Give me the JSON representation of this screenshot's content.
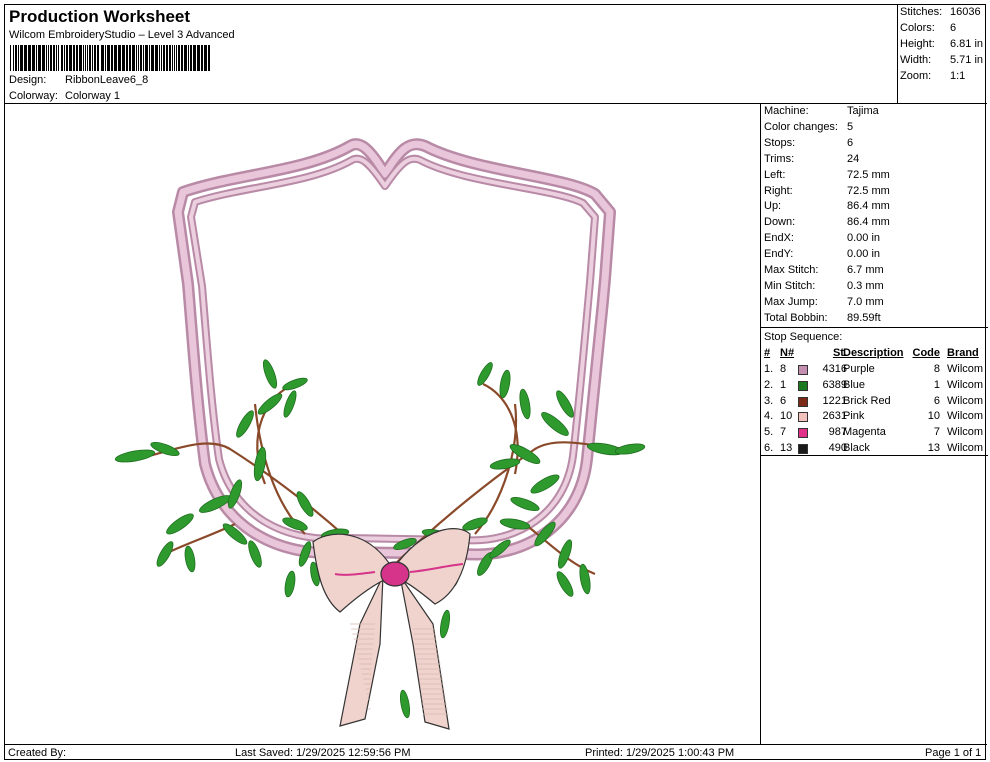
{
  "header": {
    "title": "Production Worksheet",
    "subtitle": "Wilcom EmbroideryStudio – Level 3 Advanced",
    "design_label": "Design:",
    "design_value": "RibbonLeave6_8",
    "colorway_label": "Colorway:",
    "colorway_value": "Colorway 1"
  },
  "summary": [
    {
      "label": "Stitches:",
      "value": "16036"
    },
    {
      "label": "Colors:",
      "value": "6"
    },
    {
      "label": "Height:",
      "value": "6.81 in"
    },
    {
      "label": "Width:",
      "value": "5.71 in"
    },
    {
      "label": "Zoom:",
      "value": "1:1"
    }
  ],
  "machine_info": [
    {
      "label": "Machine:",
      "value": "Tajima"
    },
    {
      "label": "Color changes:",
      "value": "5"
    },
    {
      "label": "Stops:",
      "value": "6"
    },
    {
      "label": "Trims:",
      "value": "24"
    },
    {
      "label": "Left:",
      "value": "72.5 mm"
    },
    {
      "label": "Right:",
      "value": "72.5 mm"
    },
    {
      "label": "Up:",
      "value": "86.4 mm"
    },
    {
      "label": "Down:",
      "value": "86.4 mm"
    },
    {
      "label": "EndX:",
      "value": "0.00 in"
    },
    {
      "label": "EndY:",
      "value": "0.00 in"
    },
    {
      "label": "Max Stitch:",
      "value": "6.7 mm"
    },
    {
      "label": "Min Stitch:",
      "value": "0.3 mm"
    },
    {
      "label": "Max Jump:",
      "value": "7.0 mm"
    },
    {
      "label": "Total Bobbin:",
      "value": "89.59ft"
    }
  ],
  "stop_sequence": {
    "title": "Stop Sequence:",
    "headers": {
      "idx": "#",
      "n": "N#",
      "st": "St.",
      "desc": "Description",
      "code": "Code",
      "brand": "Brand"
    },
    "rows": [
      {
        "idx": "1.",
        "n": "8",
        "color": "#c48fb0",
        "st": "4316",
        "desc": "Purple",
        "code": "8",
        "brand": "Wilcom"
      },
      {
        "idx": "2.",
        "n": "1",
        "color": "#1a7a1f",
        "st": "6389",
        "desc": "Blue",
        "code": "1",
        "brand": "Wilcom"
      },
      {
        "idx": "3.",
        "n": "6",
        "color": "#7a2a16",
        "st": "1221",
        "desc": "Brick Red",
        "code": "6",
        "brand": "Wilcom"
      },
      {
        "idx": "4.",
        "n": "10",
        "color": "#f2c2bc",
        "st": "2631",
        "desc": "Pink",
        "code": "10",
        "brand": "Wilcom"
      },
      {
        "idx": "5.",
        "n": "7",
        "color": "#e0308a",
        "st": "987",
        "desc": "Magenta",
        "code": "7",
        "brand": "Wilcom"
      },
      {
        "idx": "6.",
        "n": "13",
        "color": "#1a1a1a",
        "st": "490",
        "desc": "Black",
        "code": "13",
        "brand": "Wilcom"
      }
    ]
  },
  "footer": {
    "created_by": "Created By:",
    "last_saved": "Last Saved: 1/29/2025 12:59:56 PM",
    "printed": "Printed: 1/29/2025 1:00:43 PM",
    "page": "Page 1 of 1"
  },
  "colors": {
    "frame_pink": "#d7a8c4",
    "leaf_green": "#2e9a2e",
    "stem_brown": "#8a4a2a",
    "ribbon_pink": "#efd3cc",
    "knot_magenta": "#d6338a"
  }
}
